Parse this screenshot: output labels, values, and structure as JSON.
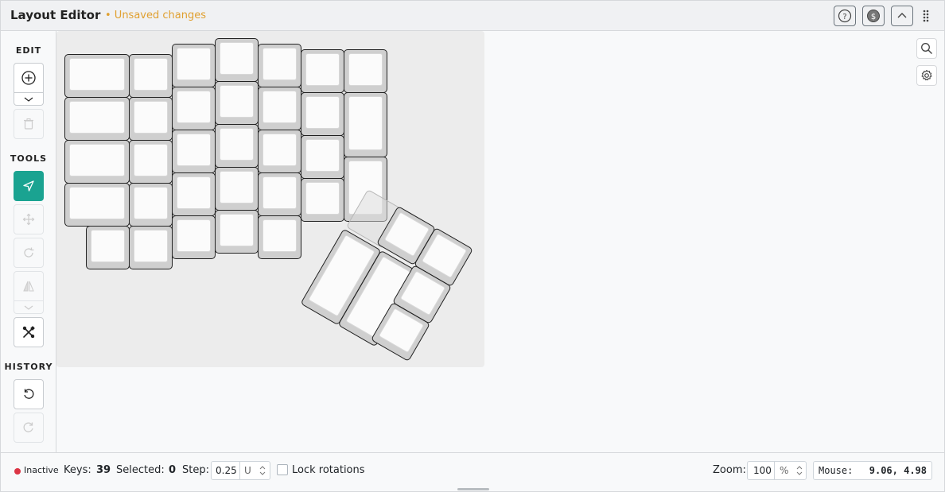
{
  "header": {
    "title": "Layout Editor",
    "unsaved": "• Unsaved changes",
    "buttons": [
      "help-icon",
      "sponsor-icon",
      "collapse-icon",
      "drag-handle-icon"
    ]
  },
  "sidebar": {
    "edit_label": "EDIT",
    "tools_label": "TOOLS",
    "history_label": "HISTORY",
    "edit_buttons": [
      "add-key-icon",
      "chevron-down-icon",
      "trash-icon"
    ],
    "tool_buttons": [
      "select-pointer-icon",
      "move-icon",
      "rotate-icon",
      "mirror-icon",
      "chevron-down-icon",
      "tools-icon"
    ],
    "history_buttons": [
      "undo-icon",
      "redo-icon"
    ]
  },
  "canvas_tools": [
    "search-icon",
    "gear-icon"
  ],
  "status": {
    "state": "Inactive",
    "keys_label": "Keys:",
    "keys_count": "39",
    "selected_label": "Selected:",
    "selected_count": "0",
    "step_label": "Step:",
    "step_value": "0.25",
    "step_unit": "U",
    "lock_label": "Lock rotations",
    "lock_checked": false,
    "zoom_label": "Zoom:",
    "zoom_value": "100",
    "zoom_unit": "%",
    "mouse_label": "Mouse:",
    "mouse_value": "9.06, 4.98"
  },
  "colors": {
    "accent": "#1aa391",
    "unsaved": "#e0a030",
    "inactive": "#dc3545"
  }
}
